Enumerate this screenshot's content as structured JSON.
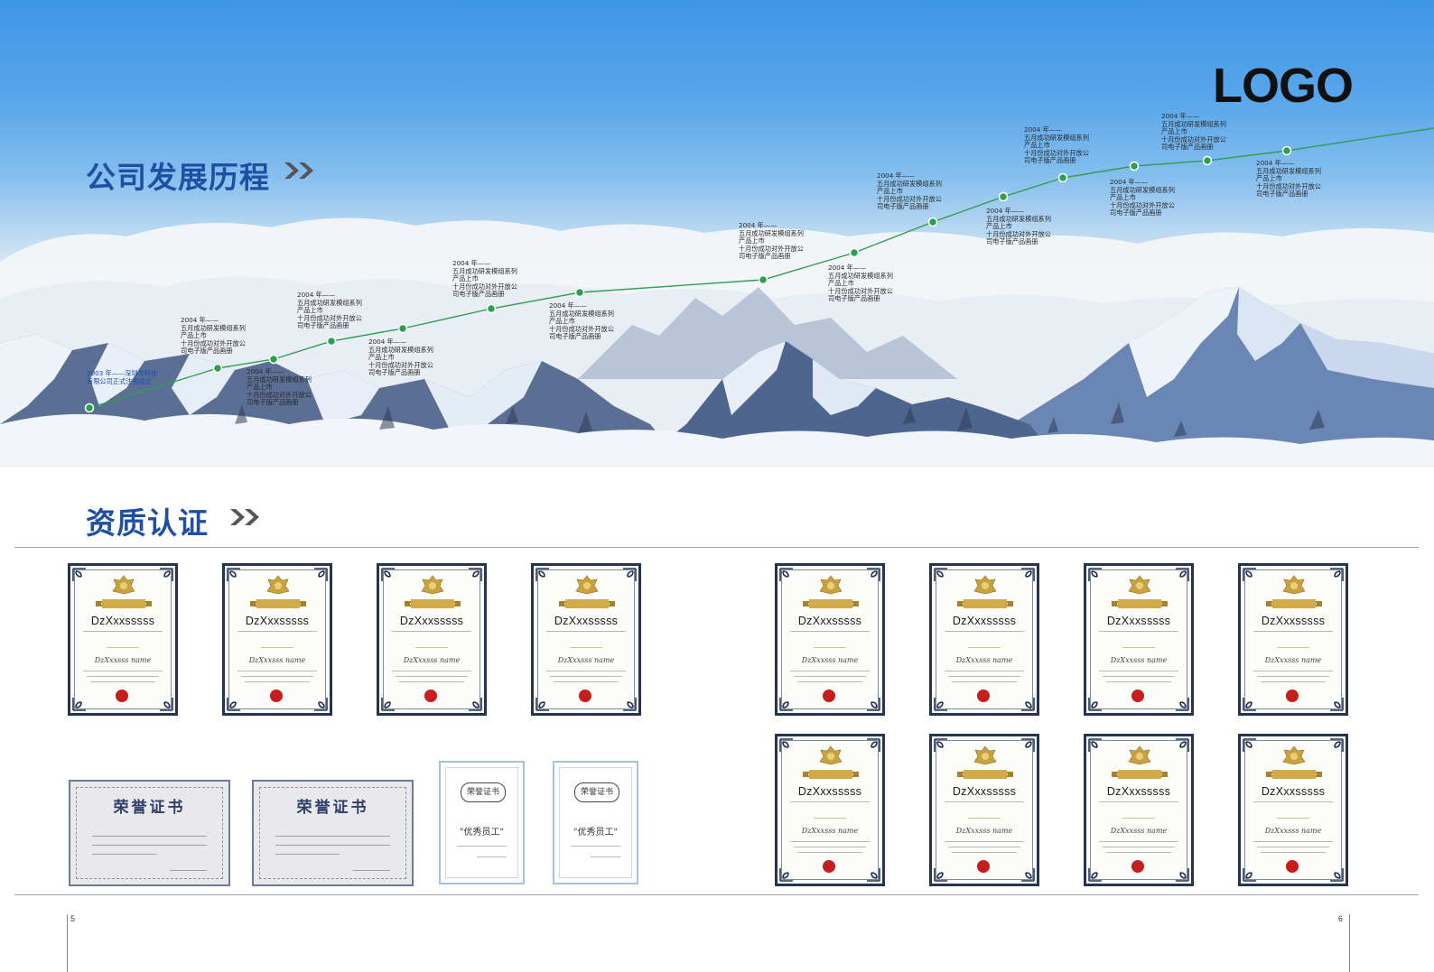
{
  "header": {
    "logo": "LOGO",
    "history_title": "公司发展历程",
    "cert_title": "资质认证"
  },
  "milestones": {
    "first": "2003 年——深圳市科技\n有限公司正式注册成立",
    "standard": "2004 年——\n五月成功研发模组系列\n产品上市\n十月份成功对外开放公\n司电子版产品画册",
    "count": 16
  },
  "certificates": {
    "vertical_name": "DzXxxsssss",
    "vertical_script": "DzXxxsss  name",
    "horizontal_title": "荣誉证书",
    "small_badge": "荣誉证书",
    "small_award": "\"优秀员工\""
  },
  "footer": {
    "left_page": "5",
    "right_page": "6"
  },
  "colors": {
    "title_blue": "#1f4fa3",
    "line_green": "#2e9e4f",
    "cert_border": "#243453"
  }
}
